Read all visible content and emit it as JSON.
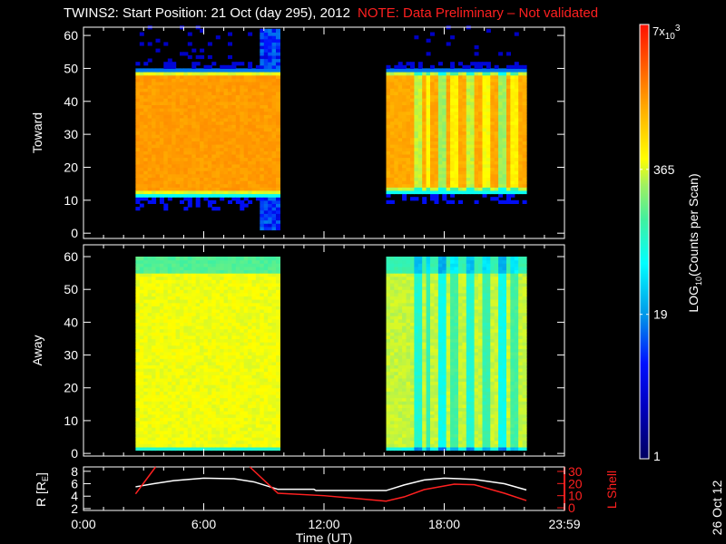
{
  "title": {
    "main": "TWINS2: Start Position: 21 Oct (day 295), 2012",
    "note": "NOTE: Data Preliminary – Not validated"
  },
  "side_date": "26 Oct 12",
  "chart_data": {
    "type": "heatmap",
    "xlabel": "Time (UT)",
    "xlim": [
      0,
      24
    ],
    "xticks": [
      {
        "v": 0,
        "label": "0:00"
      },
      {
        "v": 6,
        "label": "6:00"
      },
      {
        "v": 12,
        "label": "12:00"
      },
      {
        "v": 18,
        "label": "18:00"
      },
      {
        "v": 24,
        "label": "23:59"
      }
    ],
    "colorbar": {
      "min": 1,
      "max": 7000,
      "scale": "log",
      "label_pre": "LOG",
      "label_sub": "10",
      "label_post": "(Counts per Scan)",
      "ticks": [
        {
          "v": 1,
          "label": "1"
        },
        {
          "v": 19,
          "label": "19"
        },
        {
          "v": 365,
          "label": "365"
        }
      ],
      "top_label": {
        "base": "7x",
        "sub": "10",
        "sup": "3"
      }
    },
    "panels": [
      {
        "name": "Toward",
        "ylabel": "Toward",
        "ylim": [
          -1.6,
          62.5
        ],
        "yticks": [
          0,
          10,
          20,
          30,
          40,
          50,
          60
        ],
        "segments": [
          {
            "t": [
              2.6,
              9.7
            ],
            "band": [
              12,
              49
            ],
            "core": 1500,
            "low_tail": 7
          },
          {
            "t": [
              15.1,
              22.1
            ],
            "band": [
              13,
              49
            ],
            "core": 1300,
            "low_tail": 9
          }
        ],
        "features": [
          {
            "t": [
              8.8,
              9.7
            ],
            "from": 1,
            "to": 62,
            "counts": 4
          }
        ]
      },
      {
        "name": "Away",
        "ylabel": "Away",
        "ylim": [
          -0.8,
          63.6
        ],
        "yticks": [
          0,
          10,
          20,
          30,
          40,
          50,
          60
        ],
        "segments": [
          {
            "t": [
              2.6,
              9.7
            ],
            "band": [
              1,
              60
            ],
            "core": 420,
            "low_tail": 1
          },
          {
            "t": [
              15.1,
              22.1
            ],
            "band": [
              1,
              60
            ],
            "core": 330,
            "low_tail": 1
          }
        ],
        "features": []
      }
    ],
    "stripes": [
      [
        16.5,
        16.8,
        0.25
      ],
      [
        17.0,
        17.2,
        0.35
      ],
      [
        17.6,
        17.9,
        0.2
      ],
      [
        18.3,
        18.5,
        0.4
      ],
      [
        19.0,
        19.3,
        0.25
      ],
      [
        19.9,
        20.1,
        0.35
      ],
      [
        20.6,
        20.9,
        0.2
      ],
      [
        21.3,
        21.5,
        0.4
      ]
    ],
    "orbit": {
      "left_label": {
        "pre": "R [R",
        "sub": "E",
        "post": "]"
      },
      "right_label": "L Shell",
      "r_ylim": [
        1.7,
        8.7
      ],
      "r_ticks": [
        2,
        4,
        6,
        8
      ],
      "l_ylim": [
        -2.2,
        33.7
      ],
      "l_ticks": [
        0,
        10,
        20,
        30
      ],
      "R": [
        [
          2.6,
          5.5
        ],
        [
          3.5,
          6.0
        ],
        [
          4.5,
          6.5
        ],
        [
          6,
          6.9
        ],
        [
          7.5,
          6.8
        ],
        [
          8.5,
          6.3
        ],
        [
          9.7,
          5.1
        ],
        [
          11.5,
          5.1
        ],
        [
          11.6,
          4.9
        ],
        [
          15.1,
          4.9
        ],
        [
          16,
          5.8
        ],
        [
          17,
          6.6
        ],
        [
          18,
          6.9
        ],
        [
          19.5,
          6.7
        ],
        [
          21,
          6.0
        ],
        [
          22.1,
          5.0
        ]
      ],
      "L": [
        [
          [
            2.6,
            11.5
          ],
          [
            3.6,
            33.7
          ]
        ],
        [
          [
            8.3,
            33.7
          ],
          [
            9.7,
            12
          ],
          [
            12,
            10
          ],
          [
            15.1,
            5.5
          ],
          [
            16,
            9
          ],
          [
            17,
            15
          ],
          [
            18.5,
            19.5
          ],
          [
            19.5,
            19
          ],
          [
            21,
            12
          ],
          [
            22.1,
            6
          ]
        ]
      ]
    }
  }
}
